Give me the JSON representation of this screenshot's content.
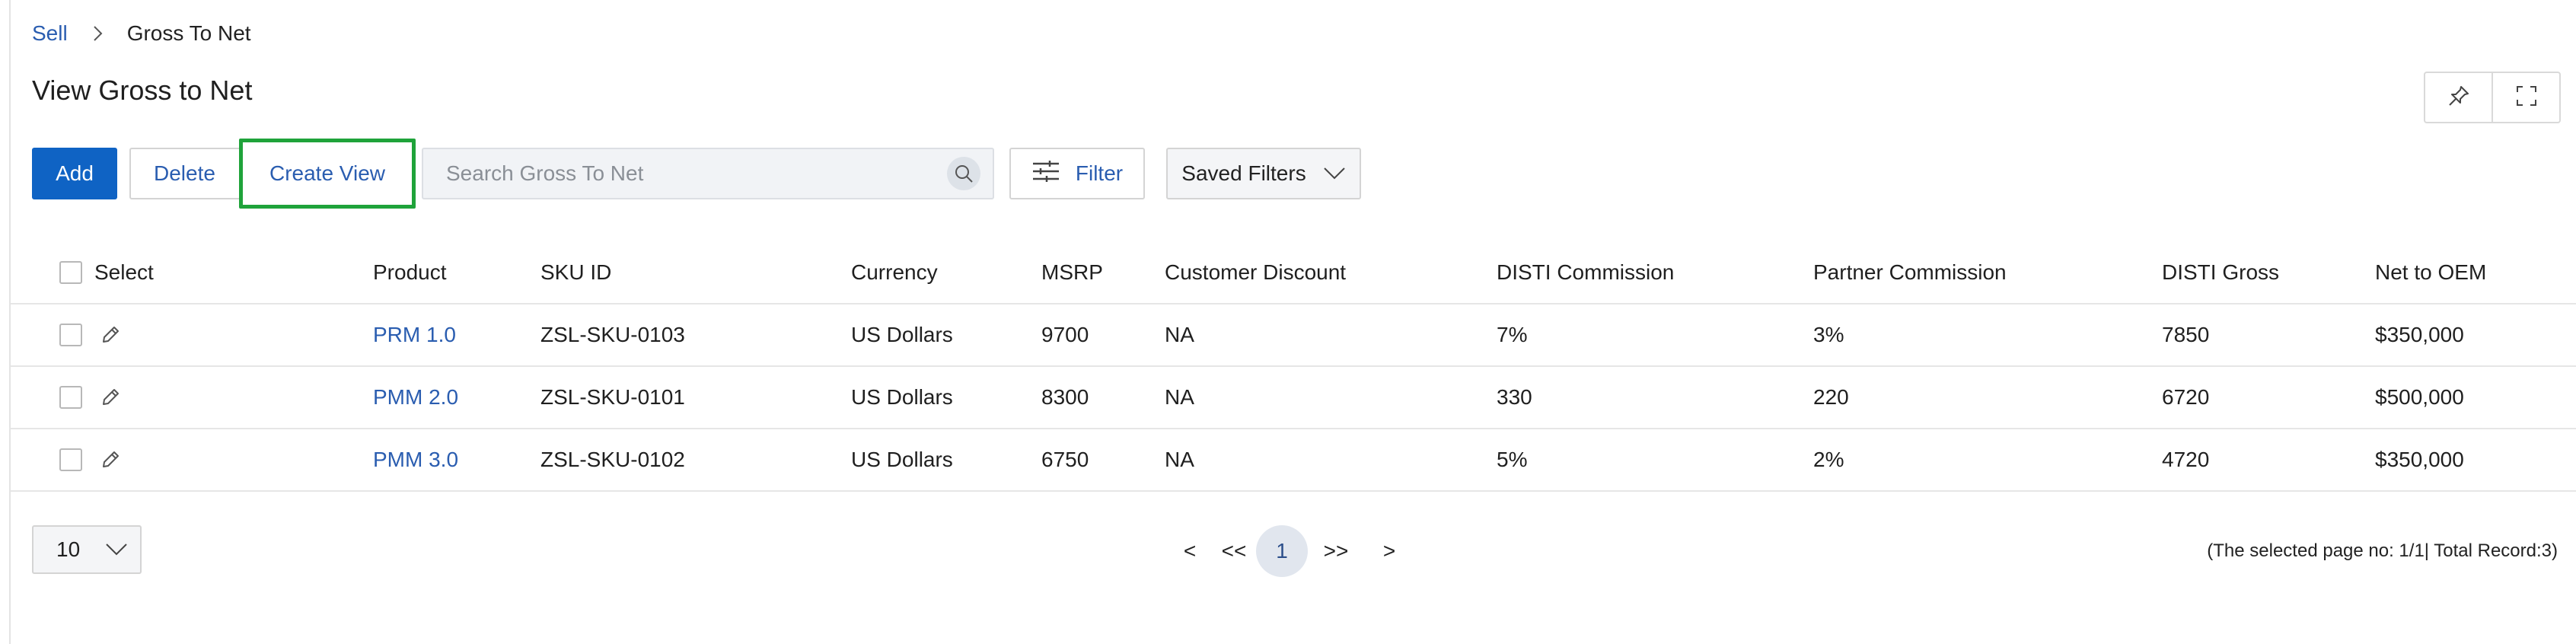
{
  "breadcrumb": {
    "root": "Sell",
    "current": "Gross To Net"
  },
  "page": {
    "title": "View Gross to Net"
  },
  "top_right": {
    "pin_icon": "pin-icon",
    "expand_icon": "fullscreen-icon"
  },
  "toolbar": {
    "add_label": "Add",
    "delete_label": "Delete",
    "create_view_label": "Create View",
    "search_placeholder": "Search Gross To Net",
    "filter_label": "Filter",
    "saved_filters_label": "Saved Filters"
  },
  "table": {
    "columns": {
      "select": "Select",
      "product": "Product",
      "sku_id": "SKU ID",
      "currency": "Currency",
      "msrp": "MSRP",
      "customer_discount": "Customer Discount",
      "disti_commission": "DISTI Commission",
      "partner_commission": "Partner Commission",
      "disti_gross": "DISTI Gross",
      "net_to_oem": "Net to OEM"
    },
    "rows": [
      {
        "product": "PRM 1.0",
        "sku_id": "ZSL-SKU-0103",
        "currency": "US Dollars",
        "msrp": "9700",
        "customer_discount": "NA",
        "disti_commission": "7%",
        "partner_commission": "3%",
        "disti_gross": "7850",
        "net_to_oem": "$350,000"
      },
      {
        "product": "PMM 2.0",
        "sku_id": "ZSL-SKU-0101",
        "currency": "US Dollars",
        "msrp": "8300",
        "customer_discount": "NA",
        "disti_commission": "330",
        "partner_commission": "220",
        "disti_gross": "6720",
        "net_to_oem": "$500,000"
      },
      {
        "product": "PMM 3.0",
        "sku_id": "ZSL-SKU-0102",
        "currency": "US Dollars",
        "msrp": "6750",
        "customer_discount": "NA",
        "disti_commission": "5%",
        "partner_commission": "2%",
        "disti_gross": "4720",
        "net_to_oem": "$350,000"
      }
    ]
  },
  "footer": {
    "page_size": "10",
    "pager": {
      "prev": "<",
      "first": "<<",
      "current": "1",
      "last": ">>",
      "next": ">"
    },
    "record_info": "(The selected page no: 1/1| Total Record:3)"
  },
  "colors": {
    "primary": "#0f63c4",
    "link": "#2a5db0",
    "highlight": "#1fa33a"
  }
}
